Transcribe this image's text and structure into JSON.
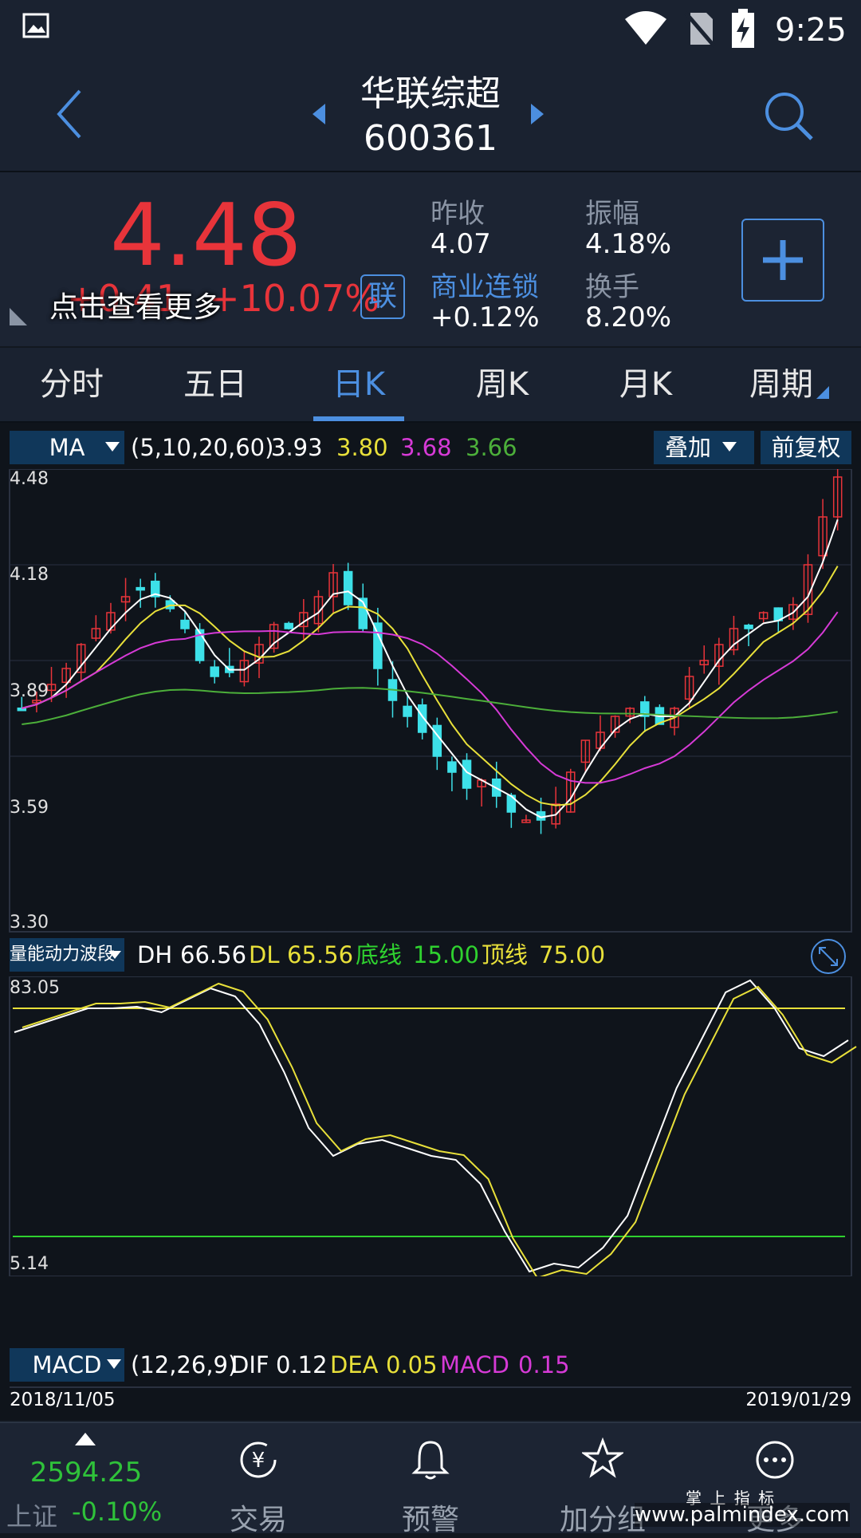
{
  "status_bar": {
    "time": "9:25"
  },
  "header": {
    "title": "华联综超",
    "code": "600361"
  },
  "quote": {
    "price": "4.48",
    "change_partial": "+0.41",
    "change_pct": "+10.07%",
    "tooltip": "点击查看更多",
    "link_badge": "联",
    "prev_close_label": "昨收",
    "prev_close": "4.07",
    "amplitude_label": "振幅",
    "amplitude": "4.18%",
    "sector_label": "商业连锁",
    "sector_change": "+0.12%",
    "turnover_label": "换手",
    "turnover": "8.20%",
    "add_label": "+"
  },
  "tabs": [
    "分时",
    "五日",
    "日K",
    "周K",
    "月K",
    "周期"
  ],
  "active_tab": 2,
  "ma_bar": {
    "indicator": "MA",
    "params": "(5,10,20,60)",
    "v1": "3.93",
    "v2": "3.80",
    "v3": "3.68",
    "v4": "3.66",
    "overlay": "叠加",
    "adjust": "前复权"
  },
  "kline_axis": {
    "y1": "4.48",
    "y2": "4.18",
    "y3": "3.89",
    "y4": "3.59",
    "y5": "3.30"
  },
  "energy_bar": {
    "indicator": "量能动力波段",
    "dh_label": "DH",
    "dh": "66.56",
    "dl_label": "DL",
    "dl": "65.56",
    "bottom_label": "底线",
    "bottom": "15.00",
    "top_label": "顶线",
    "top": "75.00",
    "top_axis": "83.05",
    "bottom_axis": "5.14"
  },
  "macd_bar": {
    "indicator": "MACD",
    "params": "(12,26,9)",
    "dif_label": "DIF",
    "dif": "0.12",
    "dea_label": "DEA",
    "dea": "0.05",
    "macd_label": "MACD",
    "macd": "0.15"
  },
  "dates": {
    "start": "2018/11/05",
    "end": "2019/01/29"
  },
  "bottom_nav": {
    "index_value": "2594.25",
    "index_name": "上证",
    "index_change": "-0.10%",
    "trade": "交易",
    "alert": "预警",
    "group": "加分组",
    "more": "更多"
  },
  "watermark": {
    "line1": "掌 上 指 标",
    "line2": "www.palmindex.com"
  },
  "colors": {
    "up": "#e8343a",
    "down": "#3de0e8",
    "ma5": "#ffffff",
    "ma10": "#e8e03a",
    "ma20": "#d63ad6",
    "ma60": "#4caf3a",
    "accent": "#4c8fe0"
  }
}
